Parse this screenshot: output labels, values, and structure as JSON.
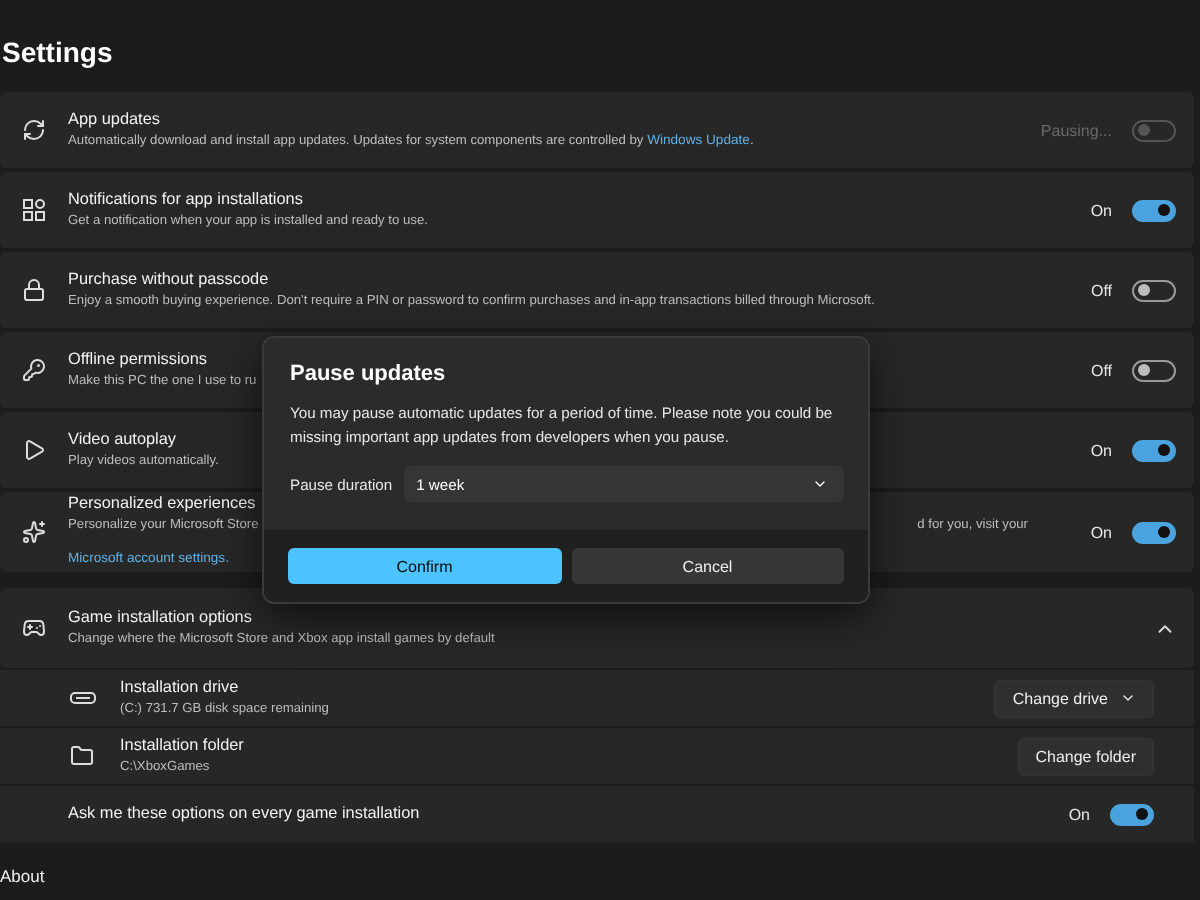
{
  "title": "Settings",
  "rows": [
    {
      "kind": "toggle",
      "title": "App updates",
      "description": "Automatically download and install app updates. Updates for system components are controlled by ",
      "link": "Windows Update",
      "link_after": ".",
      "state_label": "Pausing...",
      "on": false,
      "disabled": true
    },
    {
      "kind": "toggle",
      "title": "Notifications for app installations",
      "description": "Get a notification when your app is installed and ready to use.",
      "state_label": "On",
      "on": true,
      "disabled": false
    },
    {
      "kind": "toggle",
      "title": "Purchase without passcode",
      "description": "Enjoy a smooth buying experience. Don't require a PIN or password to confirm purchases and in-app transactions billed through Microsoft.",
      "state_label": "Off",
      "on": false,
      "disabled": false
    },
    {
      "kind": "toggle",
      "title": "Offline permissions",
      "description": "Make this PC the one I use to ru",
      "state_label": "Off",
      "on": false,
      "disabled": false
    },
    {
      "kind": "toggle",
      "title": "Video autoplay",
      "description": "Play videos automatically.",
      "state_label": "On",
      "on": true,
      "disabled": false
    },
    {
      "kind": "toggle",
      "title": "Personalized experiences",
      "description": "Personalize your Microsoft Store",
      "description_right": "d for you, visit your",
      "link": "Microsoft account settings.",
      "state_label": "On",
      "on": true,
      "disabled": false
    }
  ],
  "game": {
    "title": "Game installation options",
    "description": "Change where the Microsoft Store and Xbox app install games by default",
    "expanded": true,
    "children": [
      {
        "kind": "drive",
        "title": "Installation drive",
        "description": "(C:) 731.7 GB disk space remaining",
        "button": "Change drive"
      },
      {
        "kind": "folder",
        "title": "Installation folder",
        "description": "C:\\XboxGames",
        "button": "Change folder"
      },
      {
        "kind": "toggle",
        "title": "Ask me these options on every game installation",
        "state_label": "On",
        "on": true
      }
    ]
  },
  "next_section": "About",
  "dialog": {
    "title": "Pause updates",
    "message": "You may pause automatic updates for a period of time. Please note you could be missing important app updates from developers when you pause.",
    "field_label": "Pause duration",
    "duration": "1 week",
    "primary": "Confirm",
    "secondary": "Cancel"
  }
}
